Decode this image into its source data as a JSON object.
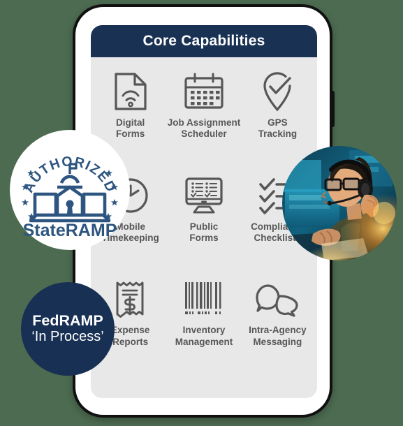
{
  "app": {
    "header_title": "Core Capabilities",
    "header_color": "#193153",
    "screen_bg": "#e8e8e8",
    "label_color": "#575757"
  },
  "capabilities": [
    {
      "icon": "document-wifi-icon",
      "label": "Digital\nForms"
    },
    {
      "icon": "calendar-icon",
      "label": "Job Assignment\nScheduler"
    },
    {
      "icon": "map-pin-check-icon",
      "label": "GPS\nTracking"
    },
    {
      "icon": "clock-icon",
      "label": "Mobile\nTimekeeping"
    },
    {
      "icon": "monitor-forms-icon",
      "label": "Public\nForms"
    },
    {
      "icon": "checklist-icon",
      "label": "Compliance\nChecklists"
    },
    {
      "icon": "receipt-dollar-icon",
      "label": "Expense\nReports"
    },
    {
      "icon": "barcode-icon",
      "label": "Inventory\nManagement"
    },
    {
      "icon": "chat-bubbles-icon",
      "label": "Intra-Agency\nMessaging"
    }
  ],
  "badges": {
    "stateramp": {
      "arc_text": "AUTHORIZED",
      "name": "StateRAMP",
      "accent_color": "#2d5580",
      "bg_color": "#ffffff"
    },
    "fedramp": {
      "line1": "FedRAMP",
      "line2": "‘In Process’",
      "bg_color": "#173053",
      "text_color": "#ffffff"
    }
  },
  "photo": {
    "alt": "Dispatcher with headset working at computer workstation"
  }
}
